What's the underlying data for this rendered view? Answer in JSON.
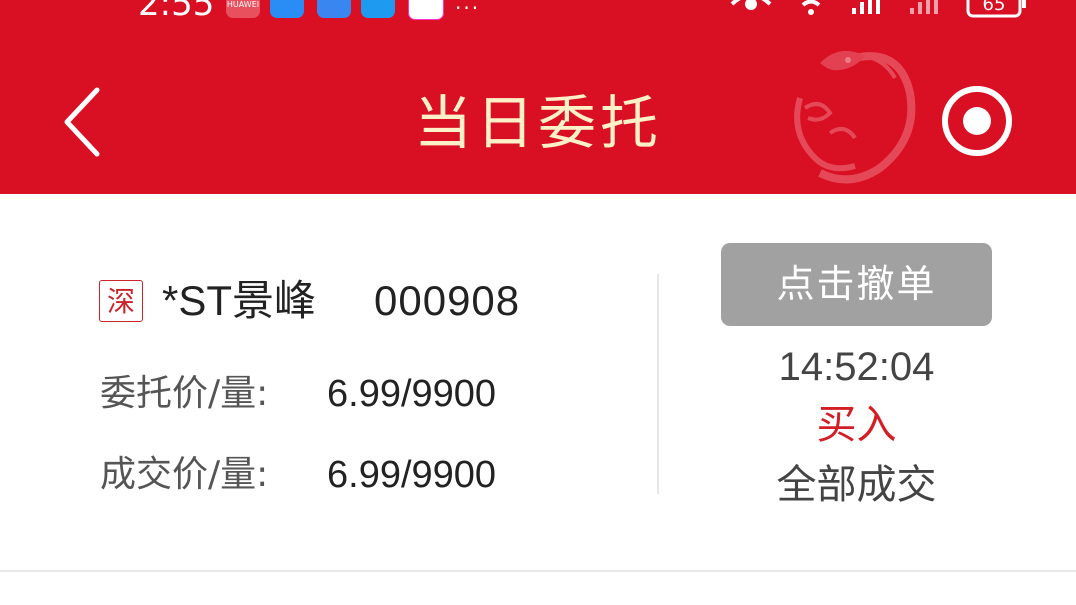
{
  "status_bar": {
    "time": "2:55",
    "app_icons": [
      "huawei-icon",
      "weather-icon",
      "cloud-icon",
      "search-icon",
      "gift-icon"
    ],
    "huawei_label": "HUAWEI",
    "more": "···",
    "battery": "65"
  },
  "header": {
    "title": "当日委托",
    "background_color": "#d90f23",
    "title_color": "#fbf0c8",
    "left_icon": "back-chevron-icon",
    "right_icon": "record-icon"
  },
  "order": {
    "market_badge": "深",
    "stock_name": "*ST景峰",
    "stock_code": "000908",
    "entrust_label": "委托价/量:",
    "entrust_value": "6.99/9900",
    "deal_label": "成交价/量:",
    "deal_value": "6.99/9900",
    "cancel_label": "点击撤单",
    "time": "14:52:04",
    "direction": "买入",
    "direction_color": "#d21f26",
    "status": "全部成交"
  }
}
